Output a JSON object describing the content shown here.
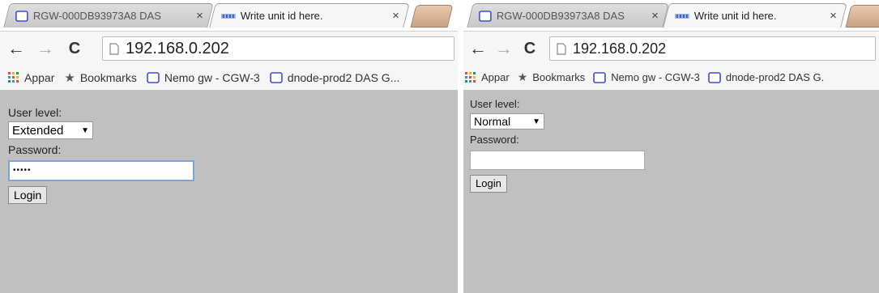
{
  "left_window": {
    "tabs": [
      {
        "title": "RGW-000DB93973A8 DAS",
        "close": "×",
        "active": false
      },
      {
        "title": "Write unit id here.",
        "close": "×",
        "active": true
      }
    ],
    "url": "192.168.0.202",
    "bookmarks": {
      "apps": "Appar",
      "bookmarks": "Bookmarks",
      "items": [
        "Nemo gw - CGW-3",
        "dnode-prod2 DAS G..."
      ]
    },
    "form": {
      "user_level_label": "User level:",
      "user_level_value": "Extended",
      "password_label": "Password:",
      "password_value": "•••••",
      "login_label": "Login"
    }
  },
  "right_window": {
    "tabs": [
      {
        "title": "RGW-000DB93973A8 DAS",
        "close": "×",
        "active": false
      },
      {
        "title": "Write unit id here.",
        "close": "×",
        "active": true
      }
    ],
    "url": "192.168.0.202",
    "bookmarks": {
      "apps": "Appar",
      "bookmarks": "Bookmarks",
      "items": [
        "Nemo gw - CGW-3",
        "dnode-prod2 DAS G."
      ]
    },
    "form": {
      "user_level_label": "User level:",
      "user_level_value": "Normal",
      "password_label": "Password:",
      "password_value": "",
      "login_label": "Login"
    }
  },
  "icons": {
    "back": "←",
    "forward": "→",
    "reload": "C",
    "select_arrow": "▼",
    "star": "★"
  },
  "colors": {
    "content_bg": "#c0c0c0",
    "focus_ring": "#7aa7e2",
    "new_tab": "#d8b497",
    "page_icon": "#3b4fd6"
  }
}
